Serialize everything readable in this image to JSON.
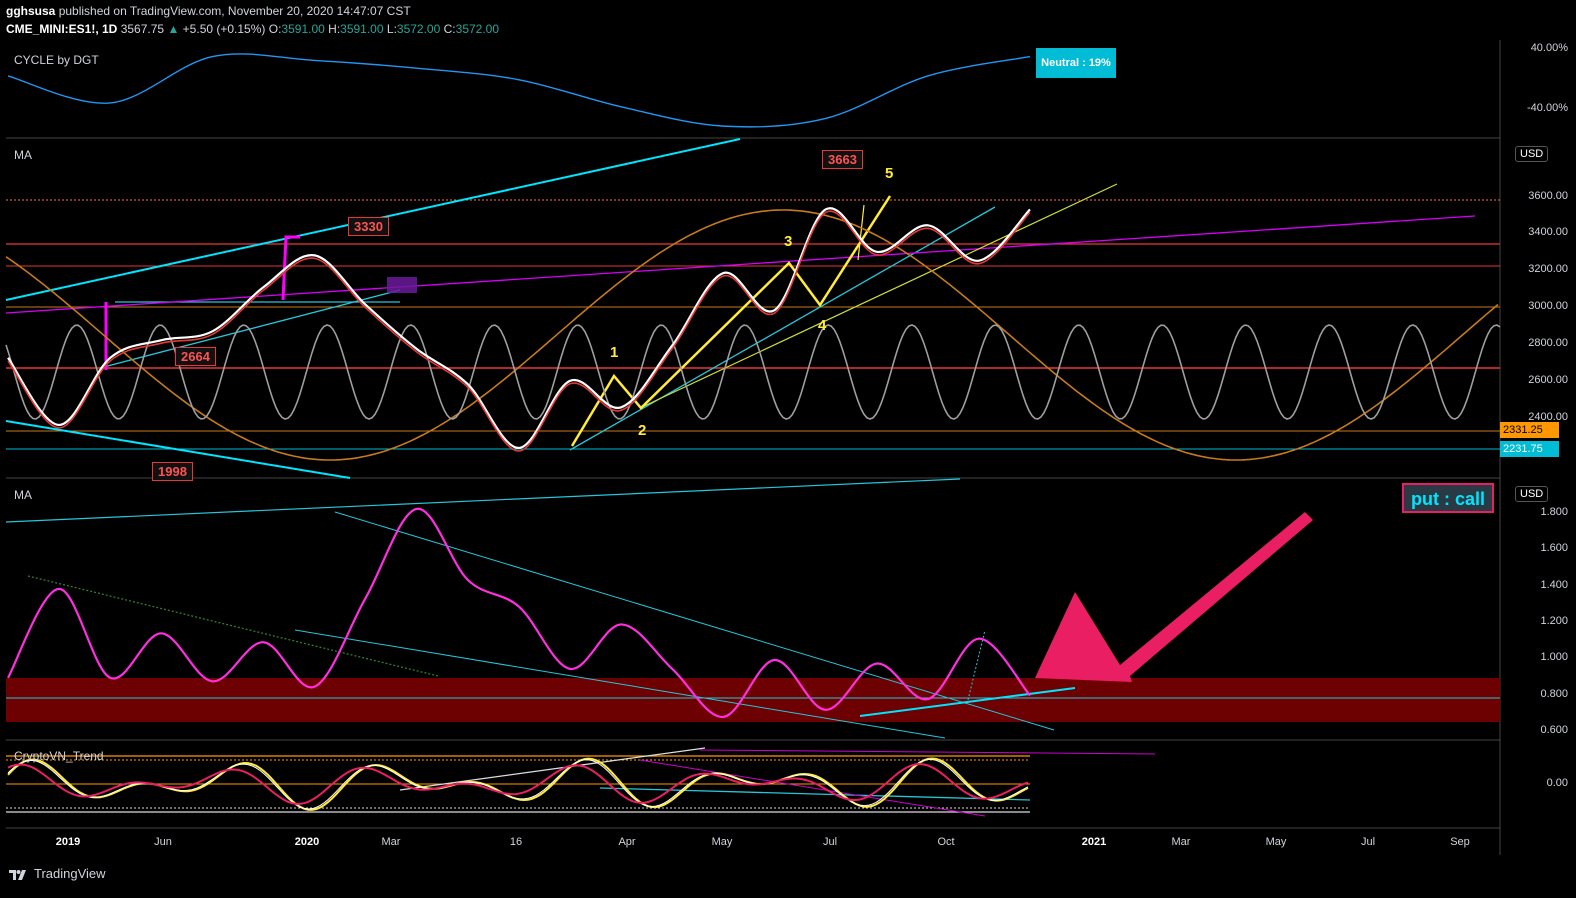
{
  "header": {
    "author": "gghsusa",
    "published": "published on TradingView.com, November 20, 2020 14:47:07 CST",
    "symbol": "CME_MINI:ES1!, 1D",
    "last": "3567.75",
    "change": "+5.50 (+0.15%)",
    "o_label": "O:",
    "o": "3591.00",
    "h_label": "H:",
    "h": "3591.00",
    "l_label": "L:",
    "l": "3572.00",
    "c_label": "C:",
    "c": "3572.00"
  },
  "panes": {
    "cycle": {
      "label": "CYCLE by DGT",
      "badge": "Neutral : 19%",
      "ticks": [
        "40.00%",
        "-40.00%"
      ]
    },
    "ma_price": {
      "label": "MA",
      "currency": "USD",
      "ticks": [
        "3600.00",
        "3400.00",
        "3200.00",
        "3000.00",
        "2800.00",
        "2600.00",
        "2400.00"
      ]
    },
    "ma_putcall": {
      "label": "MA",
      "currency": "USD",
      "title_box": "put : call",
      "ticks": [
        "1.800",
        "1.600",
        "1.400",
        "1.200",
        "1.000",
        "0.800",
        "0.600"
      ]
    },
    "trend": {
      "label": "CryptoVN_Trend",
      "ticks": [
        "0.00"
      ]
    }
  },
  "price_tags": [
    {
      "label": "2331.25",
      "color": "#ff9800"
    },
    {
      "label": "2231.75",
      "color": "#00bcd4"
    }
  ],
  "levels": [
    "3663",
    "3330",
    "2664",
    "1998"
  ],
  "waves": [
    "1",
    "2",
    "3",
    "4",
    "5"
  ],
  "x_axis": [
    {
      "label": "2019",
      "bold": true
    },
    {
      "label": "Jun",
      "bold": false
    },
    {
      "label": "2020",
      "bold": true
    },
    {
      "label": "Mar",
      "bold": false
    },
    {
      "label": "16",
      "bold": false
    },
    {
      "label": "Apr",
      "bold": false
    },
    {
      "label": "May",
      "bold": false
    },
    {
      "label": "Jul",
      "bold": false
    },
    {
      "label": "Oct",
      "bold": false
    },
    {
      "label": "2021",
      "bold": true
    },
    {
      "label": "Mar",
      "bold": false
    },
    {
      "label": "May",
      "bold": false
    },
    {
      "label": "Jul",
      "bold": false
    },
    {
      "label": "Sep",
      "bold": false
    }
  ],
  "footer": {
    "brand": "TradingView"
  },
  "colors": {
    "bg": "#000000",
    "cyan": "#00e5ff",
    "magenta": "#ff00ff",
    "red": "#e53935",
    "yellow": "#ffeb3b",
    "orange": "#c67a1d",
    "pink_arrow": "#e91e63"
  },
  "chart_data": [
    {
      "type": "line",
      "title": "CYCLE by DGT",
      "ylim": [
        -60,
        50
      ],
      "x": [
        0,
        10,
        20,
        30,
        40,
        50,
        60,
        70,
        80,
        90,
        100
      ],
      "values": [
        10,
        -25,
        35,
        30,
        20,
        5,
        -30,
        -55,
        -45,
        10,
        35
      ]
    },
    {
      "type": "line",
      "title": "MA",
      "ylabel": "USD",
      "ylim": [
        2200,
        3700
      ],
      "x": [
        0,
        5,
        10,
        15,
        20,
        25,
        30,
        35,
        40,
        45,
        50,
        55,
        60,
        65,
        70,
        75,
        80,
        85,
        90,
        95,
        100
      ],
      "values": [
        2750,
        2370,
        2750,
        2850,
        2900,
        3150,
        3330,
        3050,
        2800,
        2600,
        2240,
        2620,
        2470,
        2820,
        3230,
        3020,
        3590,
        3350,
        3500,
        3300,
        3590
      ]
    },
    {
      "type": "line",
      "title": "MA",
      "ylabel": "USD",
      "ylim": [
        0.55,
        1.9
      ],
      "x": [
        0,
        5,
        10,
        15,
        20,
        25,
        30,
        35,
        40,
        45,
        50,
        55,
        60,
        65,
        70,
        75,
        80,
        85,
        90,
        95,
        100
      ],
      "values": [
        0.9,
        1.4,
        0.9,
        1.15,
        0.88,
        1.1,
        0.85,
        1.35,
        1.85,
        1.45,
        1.3,
        0.95,
        1.2,
        0.95,
        0.68,
        1.0,
        0.72,
        0.98,
        0.78,
        1.12,
        0.8
      ]
    }
  ]
}
